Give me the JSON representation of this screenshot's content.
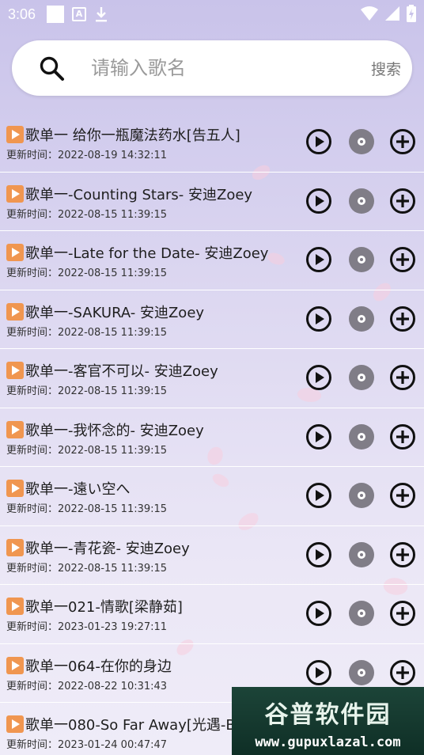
{
  "status_bar": {
    "time": "3:06",
    "icons": [
      "square-notification-icon",
      "a-notification-icon",
      "download-icon",
      "wifi-icon",
      "signal-icon",
      "battery-icon"
    ]
  },
  "search": {
    "placeholder": "请输入歌名",
    "value": "",
    "button_label": "搜索"
  },
  "songs": [
    {
      "title": "歌单一 给你一瓶魔法药水[告五人]",
      "time": "更新时间：2022-08-19 14:32:11"
    },
    {
      "title": "歌单一-Counting Stars- 安迪Zoey",
      "time": "更新时间：2022-08-15 11:39:15"
    },
    {
      "title": "歌单一-Late for the Date- 安迪Zoey",
      "time": "更新时间：2022-08-15 11:39:15"
    },
    {
      "title": "歌单一-SAKURA- 安迪Zoey",
      "time": "更新时间：2022-08-15 11:39:15"
    },
    {
      "title": "歌单一-客官不可以- 安迪Zoey",
      "time": "更新时间：2022-08-15 11:39:15"
    },
    {
      "title": "歌单一-我怀念的- 安迪Zoey",
      "time": "更新时间：2022-08-15 11:39:15"
    },
    {
      "title": "歌单一-遠い空へ",
      "time": "更新时间：2022-08-15 11:39:15"
    },
    {
      "title": "歌单一-青花瓷- 安迪Zoey",
      "time": "更新时间：2022-08-15 11:39:15"
    },
    {
      "title": "歌单一021-情歌[梁静茹]",
      "time": "更新时间：2023-01-23 19:27:11"
    },
    {
      "title": "歌单一064-在你的身边",
      "time": "更新时间：2022-08-22 10:31:43"
    },
    {
      "title": "歌单一080-So Far Away[光遇-Bl",
      "time": "更新时间：2023-01-24 00:47:47"
    }
  ],
  "row_actions": [
    "play-icon",
    "disc-icon",
    "add-icon"
  ],
  "watermark": {
    "title": "谷普软件园",
    "url": "www.gupuxlazal.com"
  },
  "colors": {
    "background_top": "#c9c3ea",
    "background_bottom": "#efecf8",
    "list_icon": "#f09650",
    "disc_icon": "#807d87",
    "watermark_bg": "#15392f"
  }
}
